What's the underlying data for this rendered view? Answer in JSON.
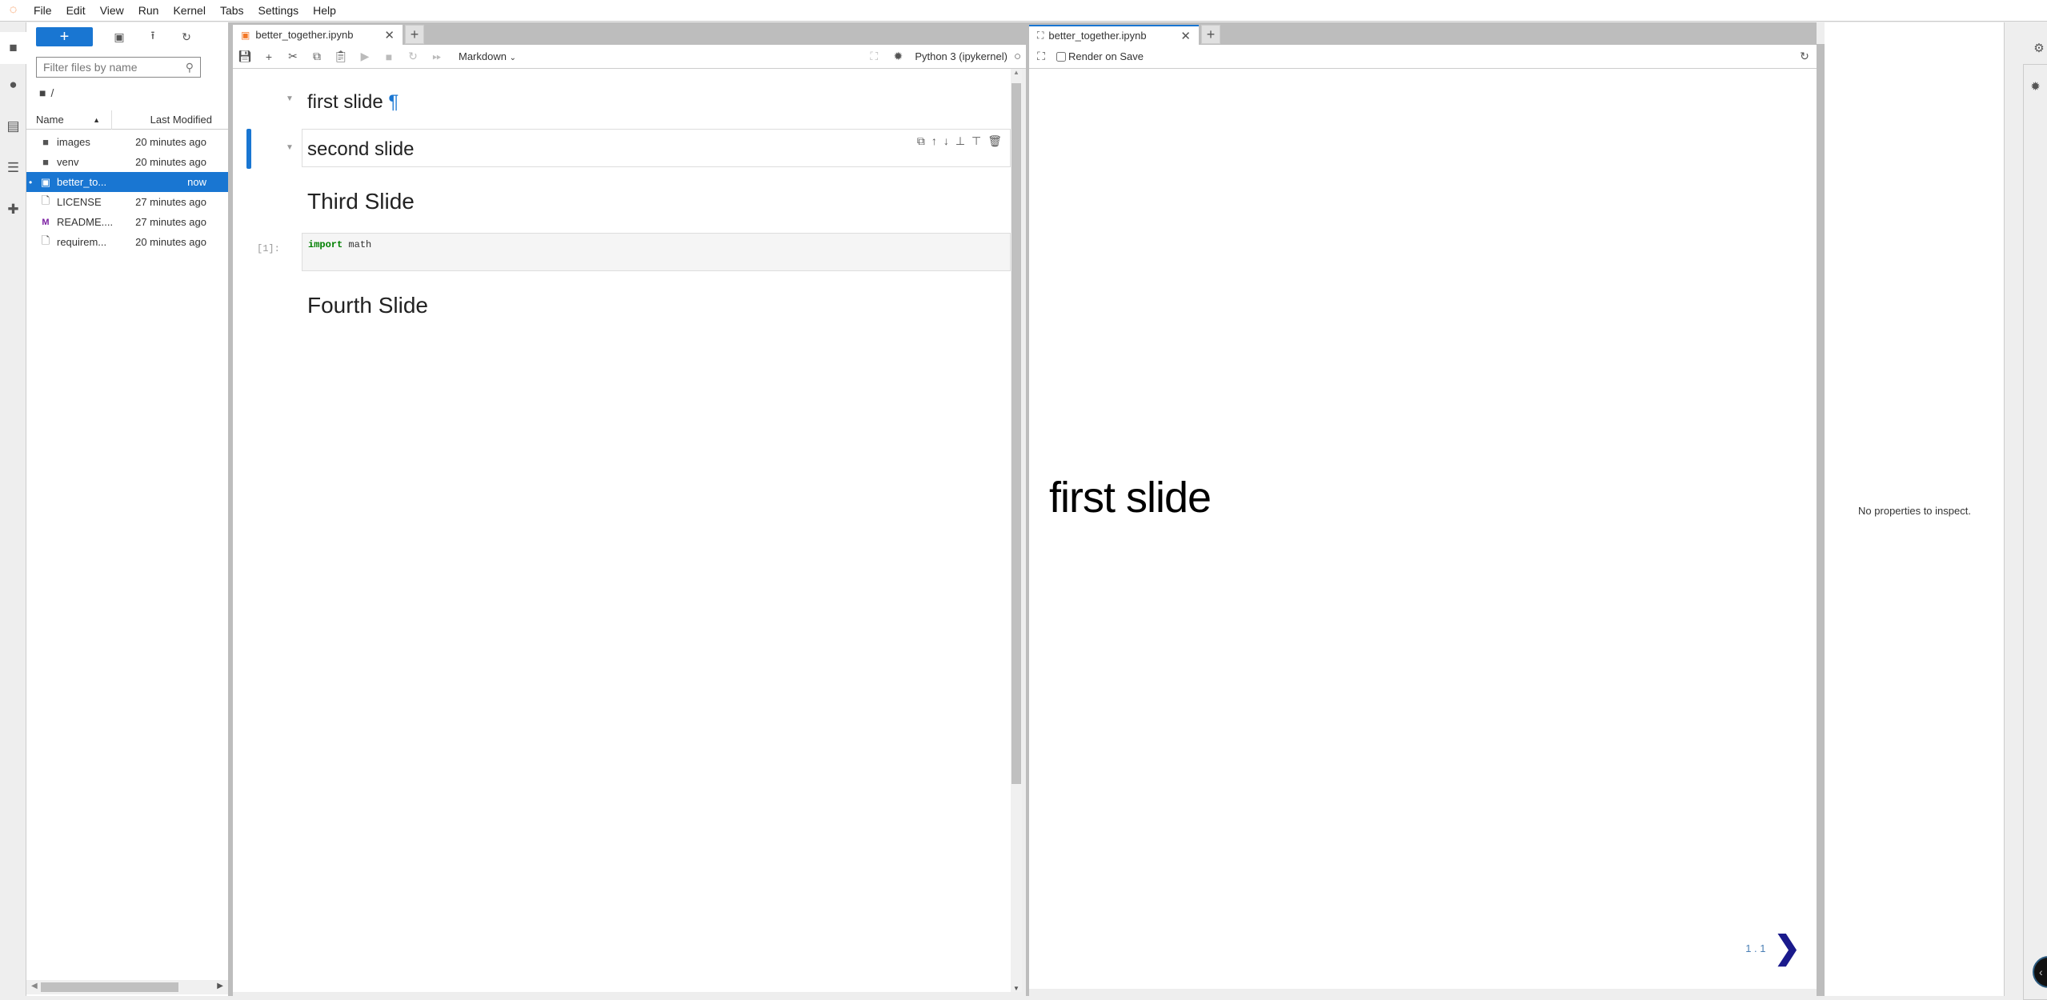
{
  "menubar": {
    "logo": "jupyter-logo",
    "items": [
      "File",
      "Edit",
      "View",
      "Run",
      "Kernel",
      "Tabs",
      "Settings",
      "Help"
    ]
  },
  "leftbar": {
    "icons": [
      "folder-icon",
      "running-icon",
      "property-inspector-icon",
      "table-of-contents-icon",
      "extension-icon"
    ]
  },
  "filebrowser": {
    "new_label": "+",
    "filter_placeholder": "Filter files by name",
    "breadcrumb": "/",
    "columns": {
      "name": "Name",
      "modified": "Last Modified"
    },
    "files": [
      {
        "icon": "folder-icon",
        "glyph": "■",
        "name": "images",
        "modified": "20 minutes ago",
        "selected": false
      },
      {
        "icon": "folder-icon",
        "glyph": "■",
        "name": "venv",
        "modified": "20 minutes ago",
        "selected": false
      },
      {
        "icon": "notebook-icon",
        "glyph": "▣",
        "name": "better_to...",
        "modified": "now",
        "selected": true
      },
      {
        "icon": "file-icon",
        "glyph": "🗋",
        "name": "LICENSE",
        "modified": "27 minutes ago",
        "selected": false
      },
      {
        "icon": "markdown-icon",
        "glyph": "M",
        "name": "README....",
        "modified": "27 minutes ago",
        "selected": false
      },
      {
        "icon": "file-icon",
        "glyph": "🗋",
        "name": "requirem...",
        "modified": "20 minutes ago",
        "selected": false
      }
    ]
  },
  "notebook": {
    "tab_title": "better_together.ipynb",
    "cell_type": "Markdown",
    "kernel": "Python 3 (ipykernel)",
    "cells": [
      {
        "type": "markdown",
        "text": "first slide",
        "anchor": "¶"
      },
      {
        "type": "markdown",
        "text": "second slide"
      },
      {
        "type": "markdown",
        "text": "Third Slide"
      },
      {
        "type": "code",
        "prompt": "[1]:",
        "keyword": "import",
        "rest": " math"
      },
      {
        "type": "markdown",
        "text": "Fourth Slide"
      }
    ]
  },
  "slideshow": {
    "tab_title": "better_together.ipynb",
    "render_on_save_label": "Render on Save",
    "render_on_save": false,
    "slide_title": "first slide",
    "slide_counter": "1 . 1"
  },
  "inspector": {
    "message": "No properties to inspect."
  },
  "colors": {
    "accent": "#1976d2",
    "slide_arrow": "#1a1a8c",
    "code_keyword": "#008000"
  }
}
